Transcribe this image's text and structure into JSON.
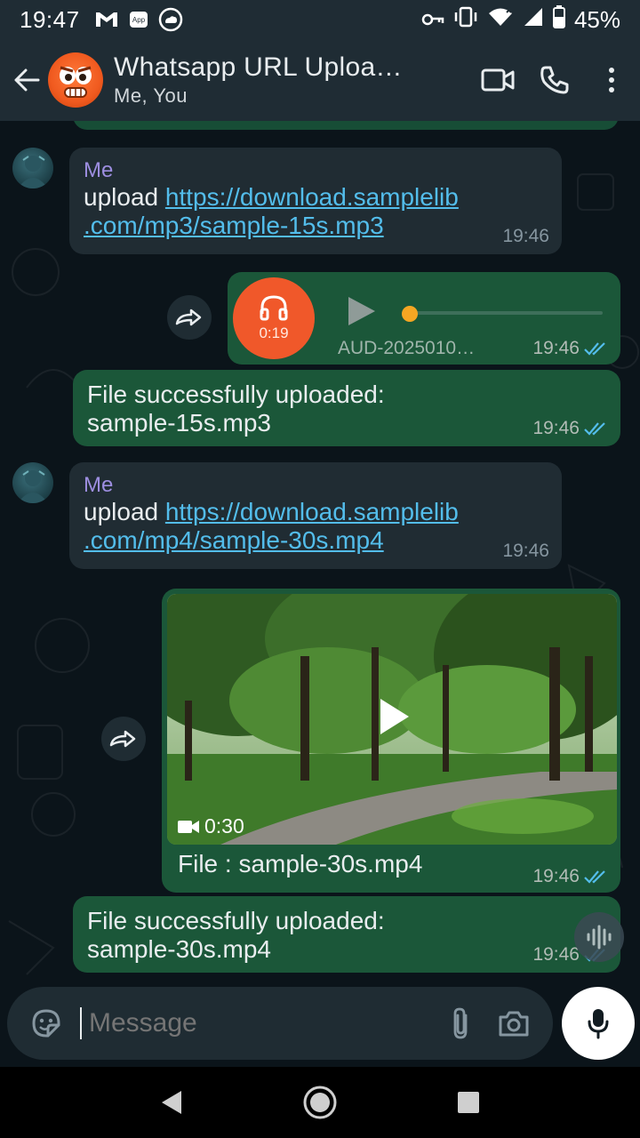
{
  "status_bar": {
    "time": "19:47",
    "battery": "45%",
    "icons": [
      "gmail-icon",
      "app-icon",
      "weather-icon",
      "vpn-key-icon",
      "vibrate-icon",
      "wifi-icon",
      "signal-icon",
      "battery-icon"
    ]
  },
  "header": {
    "title": "Whatsapp URL Uploa…",
    "subtitle": "Me, You",
    "actions": [
      "video-call-icon",
      "voice-call-icon",
      "more-vert-icon"
    ]
  },
  "messages": [
    {
      "direction": "in",
      "sender": "Me",
      "text_prefix": "upload ",
      "link_line1": "https://download.samplelib",
      "link_line2": ".com/mp3/sample-15s.mp3",
      "time": "19:46"
    },
    {
      "direction": "out",
      "type": "audio",
      "duration": "0:19",
      "filename": "AUD-2025010…",
      "time": "19:46",
      "ticks": "read",
      "progress": 0.0
    },
    {
      "direction": "out",
      "text_line1": "File successfully uploaded:",
      "text_line2": "sample-15s.mp3",
      "time": "19:46",
      "ticks": "read"
    },
    {
      "direction": "in",
      "sender": "Me",
      "text_prefix": "upload ",
      "link_line1": "https://download.samplelib",
      "link_line2": ".com/mp4/sample-30s.mp4",
      "time": "19:46"
    },
    {
      "direction": "out",
      "type": "video",
      "duration": "0:30",
      "caption": "File : sample-30s.mp4",
      "time": "19:46",
      "ticks": "read"
    },
    {
      "direction": "out",
      "text_line1": "File successfully uploaded:",
      "text_line2": "sample-30s.mp4",
      "time": "19:46",
      "ticks": "read"
    }
  ],
  "composer": {
    "placeholder": "Message",
    "icons": [
      "sticker-icon",
      "attach-icon",
      "camera-icon",
      "mic-icon"
    ]
  },
  "colors": {
    "header_bg": "#1f2c34",
    "chat_bg": "#0b141a",
    "incoming_bubble": "#202c33",
    "outgoing_bubble": "#174d36",
    "link": "#53bdeb",
    "read_ticks": "#53bdeb",
    "audio_avatar": "#f0582a"
  }
}
